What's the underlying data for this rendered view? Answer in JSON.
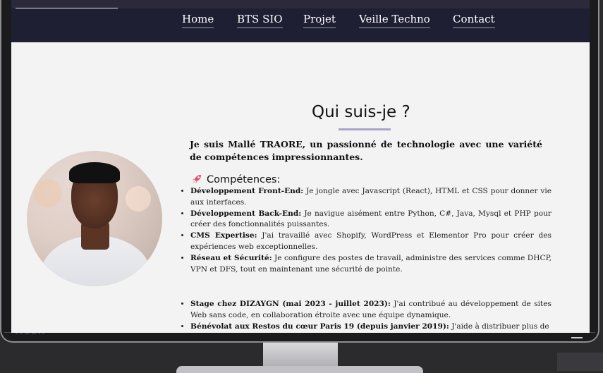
{
  "nav": {
    "items": [
      {
        "label": "Home"
      },
      {
        "label": "BTS SIO"
      },
      {
        "label": "Projet"
      },
      {
        "label": "Veille Techno"
      },
      {
        "label": "Contact"
      }
    ]
  },
  "about": {
    "title": "Qui suis-je ?",
    "intro": "Je suis Mallé TRAORE, un passionné de technologie avec une variété de compétences impressionnantes.",
    "skills_heading": "Compétences:",
    "skills": [
      {
        "title": "Développement Front-End:",
        "text": "Je jongle avec Javascript (React), HTML et CSS pour donner vie aux interfaces."
      },
      {
        "title": "Développement Back-End:",
        "text": "Je navigue aisément entre Python, C#, Java, Mysql et PHP pour créer des fonctionnalités puissantes."
      },
      {
        "title": "CMS Expertise:",
        "text": "J'ai travaillé avec Shopify, WordPress et Elementor Pro pour créer des expériences web exceptionnelles."
      },
      {
        "title": "Réseau et Sécurité:",
        "text": "Je configure des postes de travail, administre des services comme DHCP, VPN et DFS, tout en maintenant une sécurité de pointe."
      }
    ],
    "experience": [
      {
        "title": "Stage chez DIZAYGN (mai 2023 - juillet 2023):",
        "text": "J'ai contribué au développement de sites Web sans code, en collaboration étroite avec une équipe dynamique."
      },
      {
        "title": "Bénévolat aux Restos du cœur Paris 19 (depuis janvier 2019):",
        "text": "J'aide à distribuer plus de"
      }
    ]
  },
  "icons": {
    "skills": "rocket-icon",
    "profile": "avatar-photo"
  },
  "colors": {
    "navbar": "#1f1f33",
    "background": "#f3f3f3",
    "accent": "#a9a2c7"
  }
}
